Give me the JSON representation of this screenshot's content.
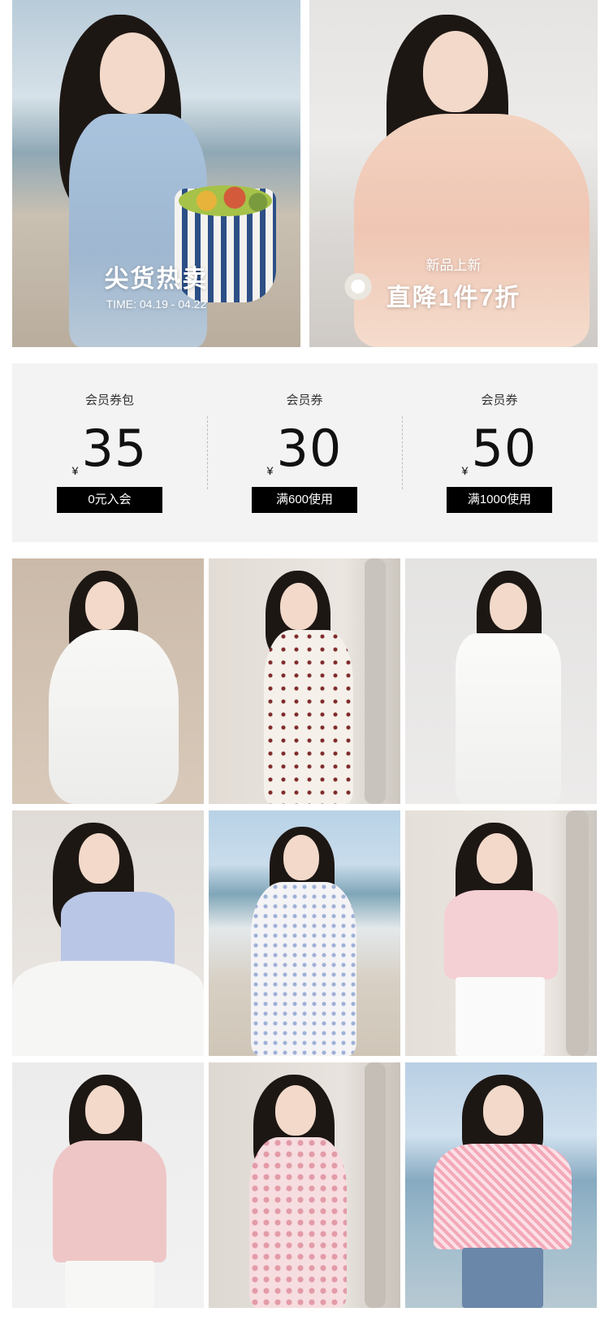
{
  "banners": [
    {
      "title": "尖货热卖",
      "subtitle": "TIME: 04.19 - 04.22"
    },
    {
      "subtitle": "新品上新",
      "title": "直降1件7折"
    }
  ],
  "coupons": [
    {
      "label": "会员券包",
      "currency": "¥",
      "value": "35",
      "button": "0元入会"
    },
    {
      "label": "会员券",
      "currency": "¥",
      "value": "30",
      "button": "满600使用"
    },
    {
      "label": "会员券",
      "currency": "¥",
      "value": "50",
      "button": "满1000使用"
    }
  ],
  "colors": {
    "coupon_panel_bg": "#f3f3f3",
    "coupon_button_bg": "#000000",
    "coupon_button_text": "#ffffff"
  },
  "products": [
    {
      "image": "white-puff-sleeve-dress-photo"
    },
    {
      "image": "polka-dot-midi-dress-photo"
    },
    {
      "image": "white-slip-maxi-dress-photo"
    },
    {
      "image": "blue-ruffle-top-photo"
    },
    {
      "image": "floral-dress-blue-cardigan-photo"
    },
    {
      "image": "pink-ruffle-blouse-photo"
    },
    {
      "image": "pink-tshirt-photo"
    },
    {
      "image": "pink-floral-ruffle-dress-photo"
    },
    {
      "image": "pink-tweed-top-photo"
    }
  ]
}
